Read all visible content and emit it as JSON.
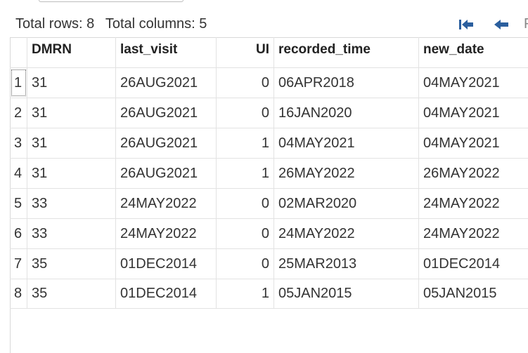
{
  "info": {
    "total_rows": "Total rows: 8",
    "total_columns": "Total columns: 5"
  },
  "nav": {
    "first_icon": "first-page-icon",
    "prev_icon": "previous-page-icon",
    "more_label": "F"
  },
  "table": {
    "columns": [
      "DMRN",
      "last_visit",
      "UI",
      "recorded_time",
      "new_date"
    ],
    "rows": [
      {
        "idx": "1",
        "DMRN": "31",
        "last_visit": "26AUG2021",
        "UI": "0",
        "recorded_time": "06APR2018",
        "new_date": "04MAY2021"
      },
      {
        "idx": "2",
        "DMRN": "31",
        "last_visit": "26AUG2021",
        "UI": "0",
        "recorded_time": "16JAN2020",
        "new_date": "04MAY2021"
      },
      {
        "idx": "3",
        "DMRN": "31",
        "last_visit": "26AUG2021",
        "UI": "1",
        "recorded_time": "04MAY2021",
        "new_date": "04MAY2021"
      },
      {
        "idx": "4",
        "DMRN": "31",
        "last_visit": "26AUG2021",
        "UI": "1",
        "recorded_time": "26MAY2022",
        "new_date": "26MAY2022"
      },
      {
        "idx": "5",
        "DMRN": "33",
        "last_visit": "24MAY2022",
        "UI": "0",
        "recorded_time": "02MAR2020",
        "new_date": "24MAY2022"
      },
      {
        "idx": "6",
        "DMRN": "33",
        "last_visit": "24MAY2022",
        "UI": "0",
        "recorded_time": "24MAY2022",
        "new_date": "24MAY2022"
      },
      {
        "idx": "7",
        "DMRN": "35",
        "last_visit": "01DEC2014",
        "UI": "0",
        "recorded_time": "25MAR2013",
        "new_date": "01DEC2014"
      },
      {
        "idx": "8",
        "DMRN": "35",
        "last_visit": "01DEC2014",
        "UI": "1",
        "recorded_time": "05JAN2015",
        "new_date": "05JAN2015"
      }
    ]
  },
  "colors": {
    "icon": "#2b5f9e",
    "grid_line": "#e2e2e2"
  }
}
